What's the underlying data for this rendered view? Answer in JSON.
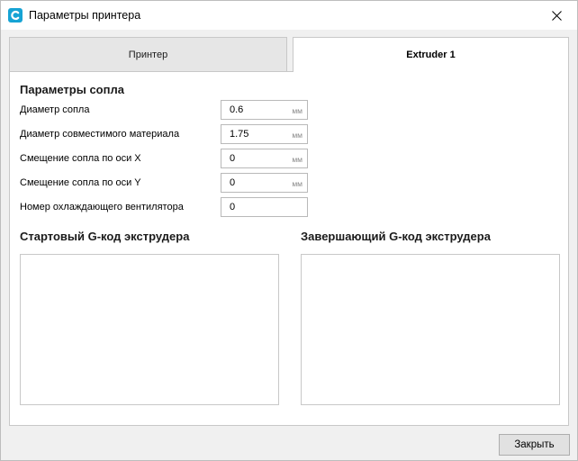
{
  "window": {
    "title": "Параметры принтера",
    "accent_color": "#16a3d4"
  },
  "tabs": [
    {
      "label": "Принтер",
      "active": false
    },
    {
      "label": "Extruder 1",
      "active": true
    }
  ],
  "nozzle_settings": {
    "title": "Параметры сопла",
    "fields": [
      {
        "label": "Диаметр сопла",
        "value": "0.6",
        "unit": "мм"
      },
      {
        "label": "Диаметр совместимого материала",
        "value": "1.75",
        "unit": "мм"
      },
      {
        "label": "Смещение сопла по оси X",
        "value": "0",
        "unit": "мм"
      },
      {
        "label": "Смещение сопла по оси Y",
        "value": "0",
        "unit": "мм"
      },
      {
        "label": "Номер охлаждающего вентилятора",
        "value": "0",
        "unit": ""
      }
    ]
  },
  "gcode": {
    "start_title": "Стартовый G-код экструдера",
    "start_value": "",
    "end_title": "Завершающий G-код экструдера",
    "end_value": ""
  },
  "footer": {
    "close_label": "Закрыть"
  }
}
